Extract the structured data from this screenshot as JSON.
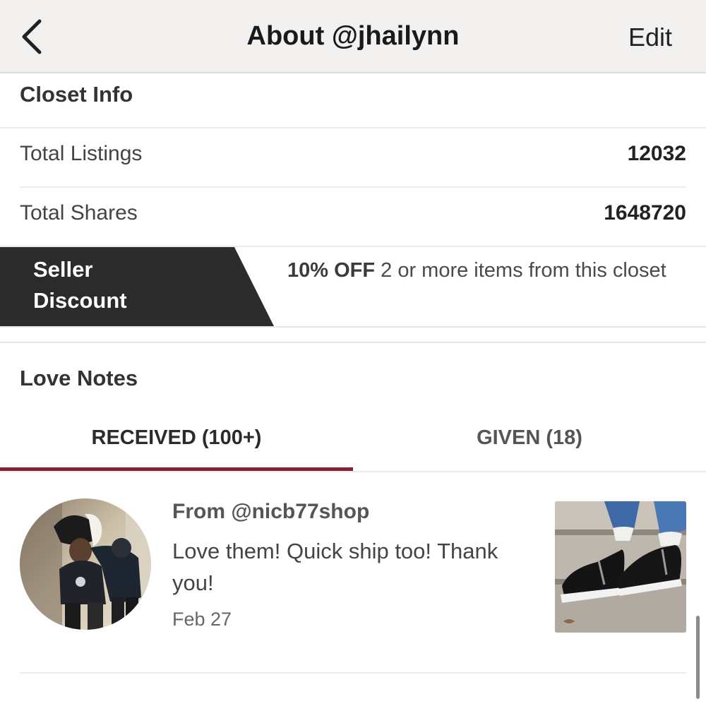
{
  "header": {
    "title": "About @jhailynn",
    "edit_label": "Edit"
  },
  "closet_info": {
    "title": "Closet Info",
    "rows": [
      {
        "label": "Total Listings",
        "value": "12032"
      },
      {
        "label": "Total Shares",
        "value": "1648720"
      }
    ]
  },
  "seller_discount": {
    "ribbon_line1": "Seller",
    "ribbon_line2": "Discount",
    "offer_bold": "10% OFF",
    "offer_text": " 2 or more items from this closet"
  },
  "love_notes": {
    "title": "Love Notes",
    "tabs": [
      {
        "label": "RECEIVED (100+)",
        "active": true
      },
      {
        "label": "GIVEN (18)",
        "active": false
      }
    ],
    "notes": [
      {
        "from": "From @nicb77shop",
        "message": "Love them! Quick ship too! Thank you!",
        "date": "Feb 27"
      }
    ]
  },
  "colors": {
    "accent": "#7f2433",
    "ribbon": "#2b2b2b",
    "header_bg": "#f2f1ef"
  },
  "icons": {
    "back": "chevron-left-icon"
  }
}
